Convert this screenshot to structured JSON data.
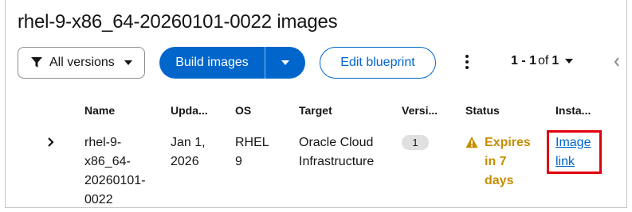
{
  "page": {
    "title": "rhel-9-x86_64-20260101-0022 images"
  },
  "toolbar": {
    "versions_label": "All versions",
    "build_label": "Build images",
    "edit_label": "Edit blueprint"
  },
  "pagination": {
    "range": "1 - 1",
    "of": "of",
    "total": "1"
  },
  "table": {
    "headers": [
      "Name",
      "Upda...",
      "OS",
      "Target",
      "Versi...",
      "Status",
      "Insta..."
    ],
    "rows": [
      {
        "name": "rhel-9-\nx86_64-\n20260101-\n0022",
        "updated": "Jan 1,\n2026",
        "os": "RHEL\n9",
        "target": "Oracle Cloud\nInfrastructure",
        "version": "1",
        "status": "Expires\nin 7\ndays",
        "instance": "Image\nlink"
      }
    ]
  },
  "colors": {
    "primary": "#0066cc",
    "warning": "#c58c00",
    "highlight": "#e0000c"
  },
  "icons": [
    "filter-icon",
    "caret-down-icon",
    "kebab-icon",
    "angle-left-icon",
    "angle-right-icon",
    "warning-triangle-icon"
  ]
}
